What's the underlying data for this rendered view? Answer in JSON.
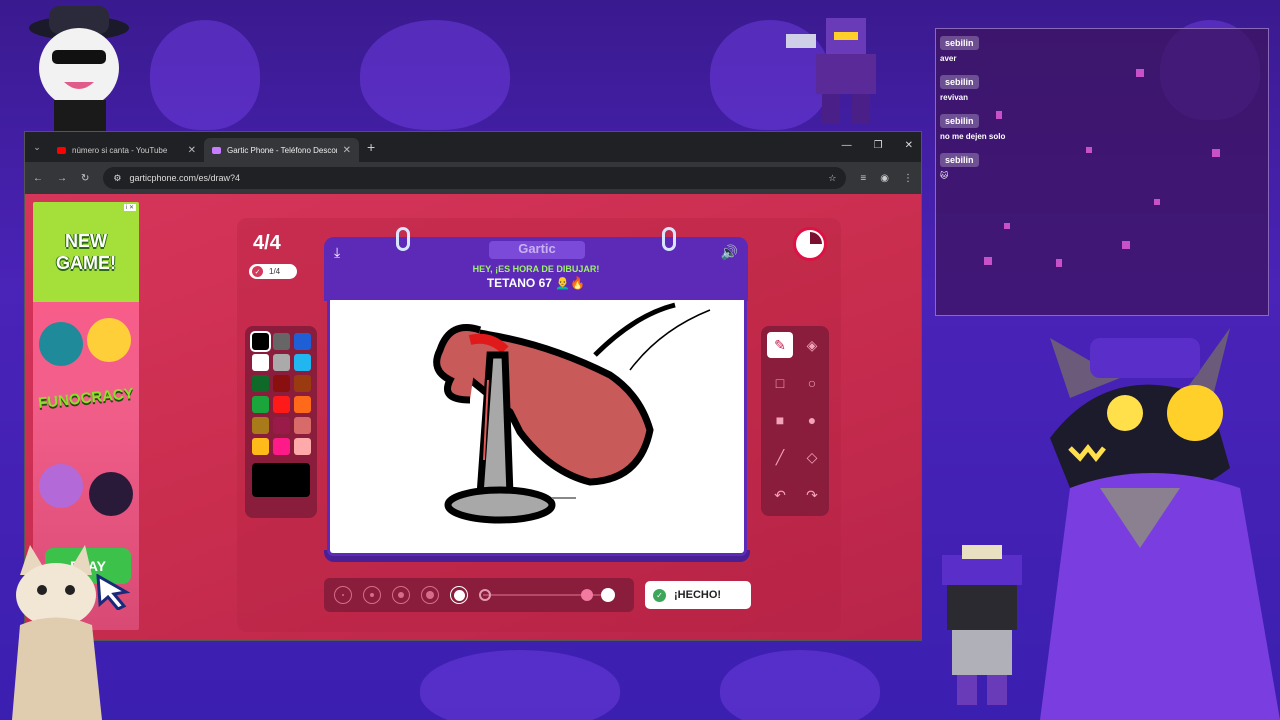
{
  "browser": {
    "tabs": [
      {
        "title": "número si canta - YouTube",
        "favicon_color": "#ff0000",
        "active": false
      },
      {
        "title": "Gartic Phone - Teléfono Descon",
        "favicon_color": "#c77dff",
        "active": true
      }
    ],
    "url": "garticphone.com/es/draw?4"
  },
  "ad": {
    "newgame": "NEW GAME!",
    "funocracy": "FUNOCRACY",
    "play": "PLAY",
    "badge": "i ✕"
  },
  "game": {
    "round": "4/4",
    "round_badge": "1/4",
    "logo": "Gartic",
    "prompt_line1": "HEY, ¡ES HORA DE DIBUJAR!",
    "prompt_line2": "TETANO 67 👨‍🦲🔥",
    "done_label": "¡HECHO!",
    "palette": [
      "#000000",
      "#666666",
      "#1e5fd6",
      "#ffffff",
      "#aaaaaa",
      "#22b6f0",
      "#0f6a2a",
      "#8a0f0f",
      "#9a3a10",
      "#1aa63a",
      "#ff1a1a",
      "#ff6a1a",
      "#a87a1a",
      "#9a1a4a",
      "#d86a6a",
      "#ffbb1a",
      "#ff1a8a",
      "#ffaaaa"
    ],
    "selected_color": "#000000",
    "tools": [
      "pencil-icon",
      "eraser-icon",
      "rect-outline-icon",
      "circle-outline-icon",
      "rect-fill-icon",
      "circle-fill-icon",
      "line-icon",
      "bucket-icon",
      "undo-icon",
      "redo-icon"
    ]
  },
  "chat": {
    "messages": [
      {
        "user": "sebilin",
        "text": "aver"
      },
      {
        "user": "sebilin",
        "text": "revivan"
      },
      {
        "user": "sebilin",
        "text": "no me dejen solo"
      },
      {
        "user": "sebilin",
        "text": "🐱"
      }
    ]
  }
}
